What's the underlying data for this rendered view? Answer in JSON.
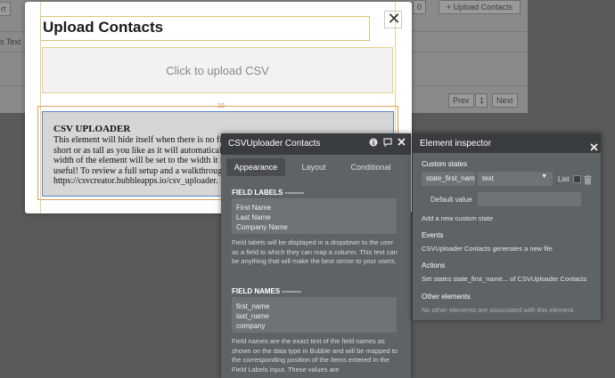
{
  "background": {
    "left_buttons": [
      "rt",
      "s Text"
    ],
    "top_right_number": "0",
    "upload_button": "+ Upload Contacts",
    "pagination": {
      "prev": "Prev",
      "next": "Next",
      "page": "1"
    }
  },
  "popup": {
    "title": "Upload Contacts",
    "close_glyph": "✕",
    "upload_label": "Click to upload CSV",
    "dimension_label": "10",
    "uploader": {
      "title": "CSV UPLOADER",
      "body_lines": [
        "This element will hide itself when there is no fi",
        "short or as tall as you like as it will automaticall",
        "width of the element will be set to the width it i",
        "useful! To review a full setup and a walkthroug",
        "https://csvcreator.bubbleapps.io/csv_uploader."
      ]
    }
  },
  "property_editor": {
    "title": "CSVUploader Contacts",
    "icons": {
      "info": "info-icon",
      "comment": "comment-icon",
      "close": "close-icon"
    },
    "tabs": [
      "Appearance",
      "Layout",
      "Conditional"
    ],
    "active_tab": "Appearance",
    "field_labels": {
      "heading": "FIELD LABELS --------",
      "values": [
        "First Name",
        "Last Name",
        "Company Name"
      ],
      "help": "Field labels will be displayed in a dropdown to the user as a field to which they can map a column. This text can be anything that will make the best sense to your users."
    },
    "field_names": {
      "heading": "FIELD NAMES --------",
      "values": [
        "first_name",
        "last_name",
        "company"
      ],
      "help": "Field names are the exact text of the field names as shown on the data type in Bubble and will be mapped to the corresponding position of the items entered in the Field Labels input. These values are"
    }
  },
  "inspector": {
    "title": "Element inspector",
    "custom_states_label": "Custom states",
    "state_name": "state_first_nam",
    "state_type": "text",
    "list_label": "List",
    "default_value_label": "Default value",
    "add_state": "Add a new custom state",
    "events_label": "Events",
    "events_text": "CSVUploader Contacts generates a new file",
    "actions_label": "Actions",
    "actions_text": "Set states state_first_name... of CSVUploader Contacts",
    "other_label": "Other elements",
    "other_text": "No other elements are associated with this element."
  }
}
